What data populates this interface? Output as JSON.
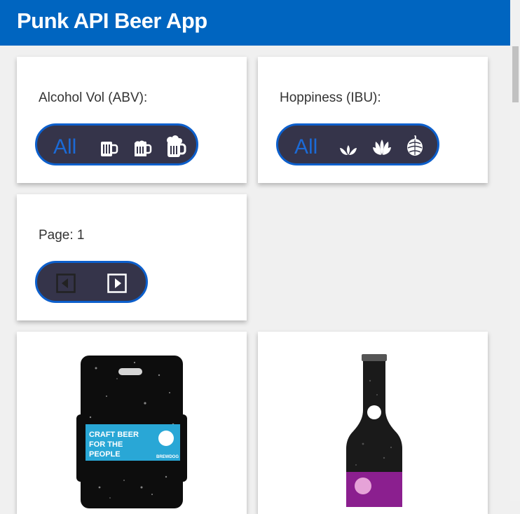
{
  "app": {
    "title": "Punk API Beer App"
  },
  "filters": {
    "abv": {
      "label": "Alcohol Vol (ABV):",
      "options": [
        "All",
        "low-abv-mug-icon",
        "medium-abv-mug-icon",
        "high-abv-mug-icon"
      ],
      "selected": "All"
    },
    "ibu": {
      "label": "Hoppiness (IBU):",
      "options": [
        "All",
        "low-ibu-hop-icon",
        "medium-ibu-hop-icon",
        "high-ibu-hop-icon"
      ],
      "selected": "All"
    }
  },
  "pagination": {
    "label": "Page: 1",
    "prev_icon": "previous-page-icon",
    "next_icon": "next-page-icon"
  },
  "beers": [
    {
      "image_text": [
        "CRAFT BEER",
        "FOR THE",
        "PEOPLE"
      ],
      "brand": "BREWDOG"
    },
    {
      "image_text": []
    }
  ],
  "colors": {
    "header": "#0065c0",
    "pill_bg": "#35344a",
    "pill_border": "#0c5fcc",
    "accent": "#1b6ad6"
  }
}
